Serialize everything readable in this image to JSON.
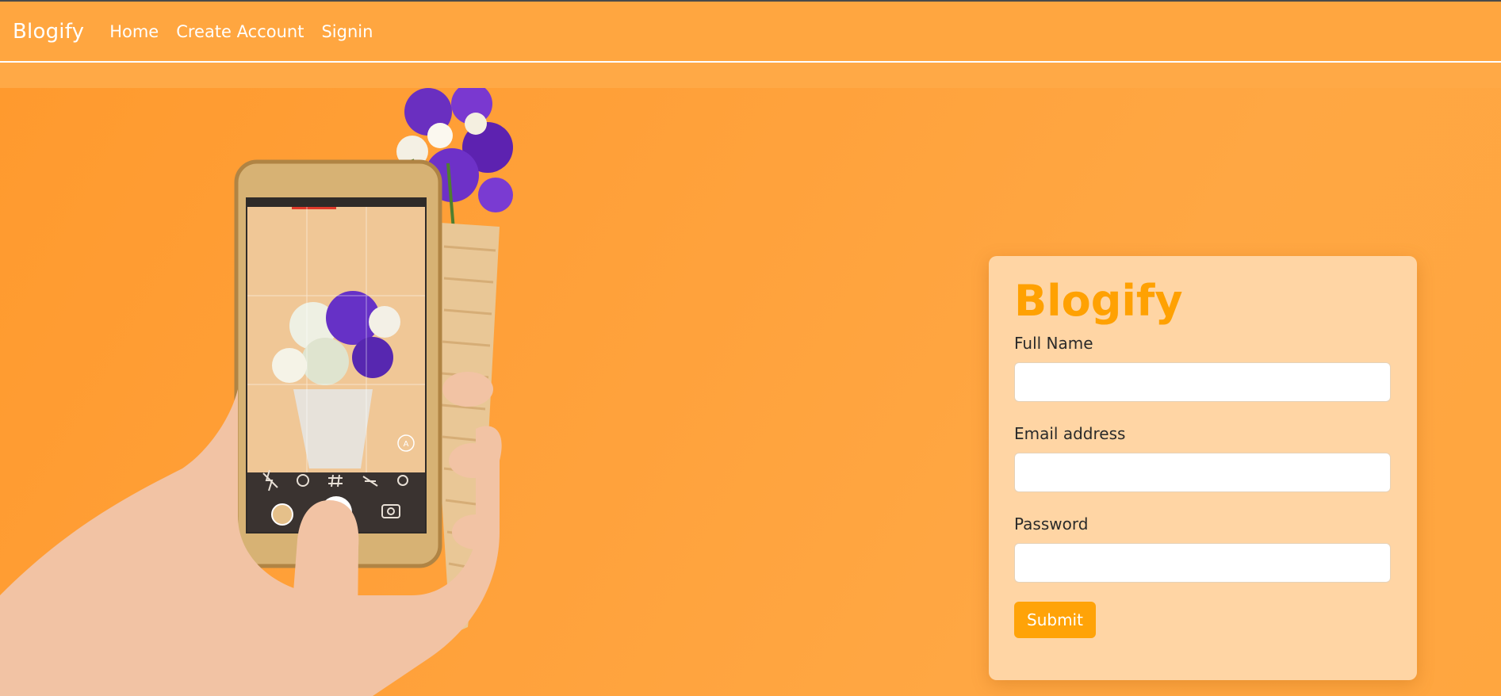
{
  "navbar": {
    "brand": "Blogify",
    "links": [
      {
        "label": "Home"
      },
      {
        "label": "Create Account"
      },
      {
        "label": "Signin"
      }
    ]
  },
  "form": {
    "title": "Blogify",
    "fields": [
      {
        "label": "Full Name",
        "value": "",
        "placeholder": ""
      },
      {
        "label": "Email address",
        "value": "",
        "placeholder": ""
      },
      {
        "label": "Password",
        "value": "",
        "placeholder": ""
      }
    ],
    "submit_label": "Submit"
  },
  "hero_image": {
    "subject": "hand holding phone photographing flower bouquet in cone",
    "icons": [
      "flash-off-icon",
      "timer-off-icon",
      "grid-icon",
      "hdr-off-icon",
      "settings-icon",
      "gallery-thumbnail-icon",
      "shutter-icon",
      "switch-camera-icon",
      "auto-mode-icon"
    ]
  },
  "colors": {
    "background": "#ffa240",
    "navbar": "#ffa640",
    "card": "#ffd5a4",
    "accent": "#ffa102",
    "button": "#ffa308"
  }
}
